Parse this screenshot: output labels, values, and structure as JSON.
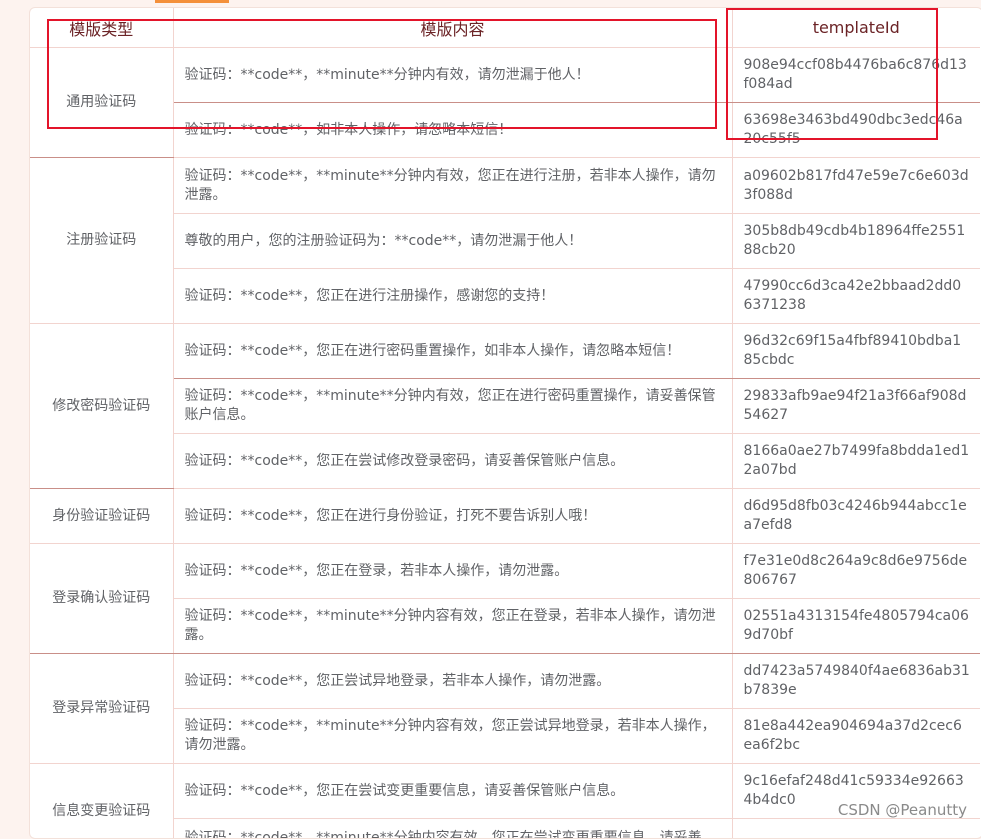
{
  "header": {
    "type_col": "模版类型",
    "content_col": "模版内容",
    "id_col": "templateId"
  },
  "groups": [
    {
      "type": "通用验证码",
      "rows": [
        {
          "content": "验证码：**code**，**minute**分钟内有效，请勿泄漏于他人！",
          "id": "908e94ccf08b4476ba6c876d13f084ad"
        },
        {
          "content": "验证码：**code**，如非本人操作，请忽略本短信！",
          "id": "63698e3463bd490dbc3edc46a20c55f5"
        }
      ]
    },
    {
      "type": "注册验证码",
      "rows": [
        {
          "content": "验证码：**code**，**minute**分钟内有效，您正在进行注册，若非本人操作，请勿泄露。",
          "id": "a09602b817fd47e59e7c6e603d3f088d"
        },
        {
          "content": "尊敬的用户，您的注册验证码为：**code**，请勿泄漏于他人！",
          "id": "305b8db49cdb4b18964ffe255188cb20"
        },
        {
          "content": "验证码：**code**，您正在进行注册操作，感谢您的支持！",
          "id": "47990cc6d3ca42e2bbaad2dd06371238"
        }
      ]
    },
    {
      "type": "修改密码验证码",
      "rows": [
        {
          "content": "验证码：**code**，您正在进行密码重置操作，如非本人操作，请忽略本短信！",
          "id": "96d32c69f15a4fbf89410bdba185cbdc"
        },
        {
          "content": "验证码：**code**，**minute**分钟内有效，您正在进行密码重置操作，请妥善保管账户信息。",
          "id": "29833afb9ae94f21a3f66af908d54627"
        },
        {
          "content": "验证码：**code**，您正在尝试修改登录密码，请妥善保管账户信息。",
          "id": "8166a0ae27b7499fa8bdda1ed12a07bd"
        }
      ]
    },
    {
      "type": "身份验证验证码",
      "rows": [
        {
          "content": "验证码：**code**，您正在进行身份验证，打死不要告诉别人哦！",
          "id": "d6d95d8fb03c4246b944abcc1ea7efd8"
        }
      ]
    },
    {
      "type": "登录确认验证码",
      "rows": [
        {
          "content": "验证码：**code**，您正在登录，若非本人操作，请勿泄露。",
          "id": "f7e31e0d8c264a9c8d6e9756de806767"
        },
        {
          "content": "验证码：**code**，**minute**分钟内容有效，您正在登录，若非本人操作，请勿泄露。",
          "id": "02551a4313154fe4805794ca069d70bf"
        }
      ]
    },
    {
      "type": "登录异常验证码",
      "rows": [
        {
          "content": "验证码：**code**，您正尝试异地登录，若非本人操作，请勿泄露。",
          "id": "dd7423a5749840f4ae6836ab31b7839e"
        },
        {
          "content": "验证码：**code**，**minute**分钟内容有效，您正尝试异地登录，若非本人操作，请勿泄露。",
          "id": "81e8a442ea904694a37d2cec6ea6f2bc"
        }
      ]
    },
    {
      "type": "信息变更验证码",
      "rows": [
        {
          "content": "验证码：**code**，您正在尝试变更重要信息，请妥善保管账户信息。",
          "id": "9c16efaf248d41c59334e926634b4dc0"
        },
        {
          "content": "验证码：**code**，**minute**分钟内容有效，您正在尝试变更重要信息，请妥善",
          "id": ""
        }
      ]
    }
  ],
  "watermark": "CSDN @Peanutty",
  "colors": {
    "border": "#f2d4cf",
    "header_text": "#6b2326",
    "highlight": "#e3142a",
    "accent": "#f4903a"
  }
}
